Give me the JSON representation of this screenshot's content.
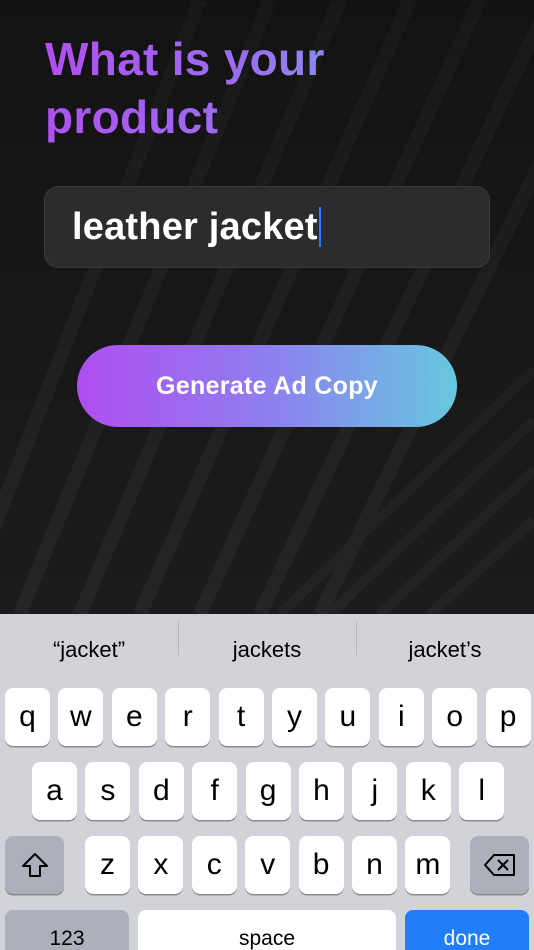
{
  "title": {
    "line1": "What is your",
    "line2": "product"
  },
  "input": {
    "value": "leather jacket"
  },
  "generate_button": {
    "label": "Generate Ad Copy"
  },
  "keyboard": {
    "suggestions": [
      "“jacket”",
      "jackets",
      "jacket’s"
    ],
    "row1": [
      "q",
      "w",
      "e",
      "r",
      "t",
      "y",
      "u",
      "i",
      "o",
      "p"
    ],
    "row2": [
      "a",
      "s",
      "d",
      "f",
      "g",
      "h",
      "j",
      "k",
      "l"
    ],
    "row3": [
      "z",
      "x",
      "c",
      "v",
      "b",
      "n",
      "m"
    ],
    "numbers_label": "123",
    "space_label": "space",
    "done_label": "done"
  },
  "colors": {
    "accent_purple": "#b04ef0",
    "accent_cyan": "#66c8e0",
    "done_blue": "#1f7ef8",
    "caret_blue": "#2f7cf6"
  }
}
